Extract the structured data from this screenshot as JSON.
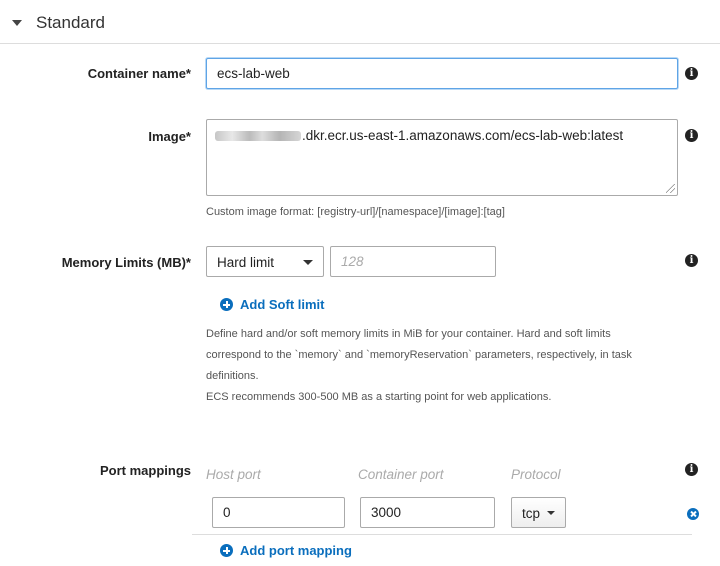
{
  "section": {
    "title": "Standard",
    "icon": "caret-down-icon"
  },
  "container_name": {
    "label": "Container name*",
    "value": "ecs-lab-web",
    "icon": "info-icon"
  },
  "image": {
    "label": "Image*",
    "value_suffix": ".dkr.ecr.us-east-1.amazonaws.com/ecs-lab-web:latest",
    "help": "Custom image format: [registry-url]/[namespace]/[image]:[tag]",
    "icon": "info-icon"
  },
  "memory": {
    "label": "Memory Limits (MB)*",
    "limit_type": "Hard limit",
    "placeholder": "128",
    "add_soft_limit": "Add Soft limit",
    "help_lines": [
      "Define hard and/or soft memory limits in MiB for your container. Hard and soft limits",
      "correspond to the `memory` and `memoryReservation` parameters, respectively, in task",
      "definitions.",
      "ECS recommends 300-500 MB as a starting point for web applications."
    ],
    "icon": "info-icon"
  },
  "ports": {
    "label": "Port mappings",
    "col_host": "Host port",
    "col_container": "Container port",
    "col_protocol": "Protocol",
    "rows": [
      {
        "host_port": "0",
        "container_port": "3000",
        "protocol": "tcp"
      }
    ],
    "add_mapping": "Add port mapping",
    "icon": "info-icon"
  },
  "colors": {
    "link": "#0a6ebd",
    "focus_border": "#5fa4e6",
    "text": "#333333"
  }
}
